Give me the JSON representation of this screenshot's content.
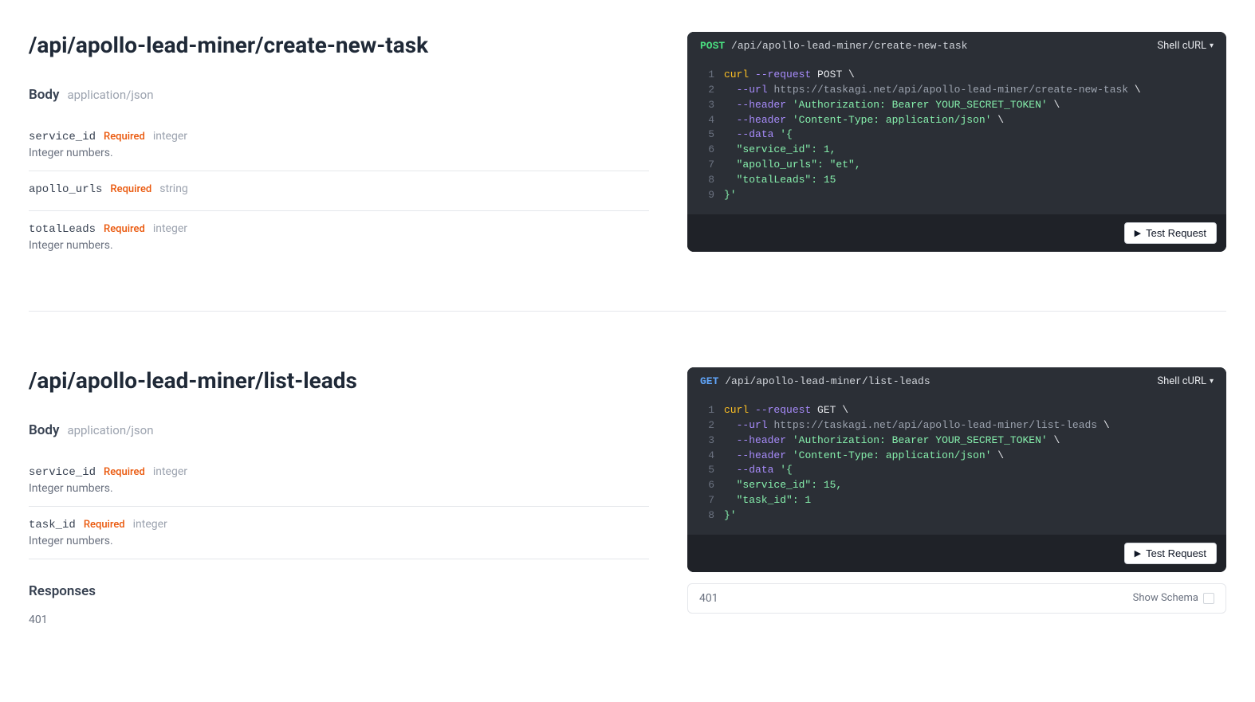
{
  "endpoints": [
    {
      "title": "/api/apollo-lead-miner/create-new-task",
      "body_label": "Body",
      "content_type": "application/json",
      "params": [
        {
          "name": "service_id",
          "required": "Required",
          "type": "integer",
          "desc": "Integer numbers."
        },
        {
          "name": "apollo_urls",
          "required": "Required",
          "type": "string",
          "desc": ""
        },
        {
          "name": "totalLeads",
          "required": "Required",
          "type": "integer",
          "desc": "Integer numbers."
        }
      ],
      "code": {
        "method": "POST",
        "path": "/api/apollo-lead-miner/create-new-task",
        "shell_label": "Shell cURL",
        "test_label": "Test Request",
        "lines": [
          {
            "n": "1",
            "tokens": [
              {
                "t": "curl",
                "c": "tok-cmd"
              },
              {
                "t": " ",
                "c": ""
              },
              {
                "t": "--request",
                "c": "tok-flag"
              },
              {
                "t": " POST \\",
                "c": "tok-plain"
              }
            ]
          },
          {
            "n": "2",
            "tokens": [
              {
                "t": "  ",
                "c": ""
              },
              {
                "t": "--url",
                "c": "tok-flag"
              },
              {
                "t": " ",
                "c": ""
              },
              {
                "t": "https://taskagi.net/api/apollo-lead-miner/create-new-task",
                "c": "tok-url"
              },
              {
                "t": " \\",
                "c": "tok-plain"
              }
            ]
          },
          {
            "n": "3",
            "tokens": [
              {
                "t": "  ",
                "c": ""
              },
              {
                "t": "--header",
                "c": "tok-flag"
              },
              {
                "t": " ",
                "c": ""
              },
              {
                "t": "'Authorization: Bearer YOUR_SECRET_TOKEN'",
                "c": "tok-str"
              },
              {
                "t": " \\",
                "c": "tok-plain"
              }
            ]
          },
          {
            "n": "4",
            "tokens": [
              {
                "t": "  ",
                "c": ""
              },
              {
                "t": "--header",
                "c": "tok-flag"
              },
              {
                "t": " ",
                "c": ""
              },
              {
                "t": "'Content-Type: application/json'",
                "c": "tok-str"
              },
              {
                "t": " \\",
                "c": "tok-plain"
              }
            ]
          },
          {
            "n": "5",
            "tokens": [
              {
                "t": "  ",
                "c": ""
              },
              {
                "t": "--data",
                "c": "tok-flag"
              },
              {
                "t": " ",
                "c": ""
              },
              {
                "t": "'{",
                "c": "tok-str"
              }
            ]
          },
          {
            "n": "6",
            "tokens": [
              {
                "t": "  \"service_id\": 1,",
                "c": "tok-str"
              }
            ]
          },
          {
            "n": "7",
            "tokens": [
              {
                "t": "  \"apollo_urls\": \"et\",",
                "c": "tok-str"
              }
            ]
          },
          {
            "n": "8",
            "tokens": [
              {
                "t": "  \"totalLeads\": 15",
                "c": "tok-str"
              }
            ]
          },
          {
            "n": "9",
            "tokens": [
              {
                "t": "}'",
                "c": "tok-str"
              }
            ]
          }
        ]
      }
    },
    {
      "title": "/api/apollo-lead-miner/list-leads",
      "body_label": "Body",
      "content_type": "application/json",
      "params": [
        {
          "name": "service_id",
          "required": "Required",
          "type": "integer",
          "desc": "Integer numbers."
        },
        {
          "name": "task_id",
          "required": "Required",
          "type": "integer",
          "desc": "Integer numbers."
        }
      ],
      "responses_label": "Responses",
      "responses": [
        {
          "code": "401"
        }
      ],
      "code": {
        "method": "GET",
        "path": "/api/apollo-lead-miner/list-leads",
        "shell_label": "Shell cURL",
        "test_label": "Test Request",
        "lines": [
          {
            "n": "1",
            "tokens": [
              {
                "t": "curl",
                "c": "tok-cmd"
              },
              {
                "t": " ",
                "c": ""
              },
              {
                "t": "--request",
                "c": "tok-flag"
              },
              {
                "t": " GET \\",
                "c": "tok-plain"
              }
            ]
          },
          {
            "n": "2",
            "tokens": [
              {
                "t": "  ",
                "c": ""
              },
              {
                "t": "--url",
                "c": "tok-flag"
              },
              {
                "t": " ",
                "c": ""
              },
              {
                "t": "https://taskagi.net/api/apollo-lead-miner/list-leads",
                "c": "tok-url"
              },
              {
                "t": " \\",
                "c": "tok-plain"
              }
            ]
          },
          {
            "n": "3",
            "tokens": [
              {
                "t": "  ",
                "c": ""
              },
              {
                "t": "--header",
                "c": "tok-flag"
              },
              {
                "t": " ",
                "c": ""
              },
              {
                "t": "'Authorization: Bearer YOUR_SECRET_TOKEN'",
                "c": "tok-str"
              },
              {
                "t": " \\",
                "c": "tok-plain"
              }
            ]
          },
          {
            "n": "4",
            "tokens": [
              {
                "t": "  ",
                "c": ""
              },
              {
                "t": "--header",
                "c": "tok-flag"
              },
              {
                "t": " ",
                "c": ""
              },
              {
                "t": "'Content-Type: application/json'",
                "c": "tok-str"
              },
              {
                "t": " \\",
                "c": "tok-plain"
              }
            ]
          },
          {
            "n": "5",
            "tokens": [
              {
                "t": "  ",
                "c": ""
              },
              {
                "t": "--data",
                "c": "tok-flag"
              },
              {
                "t": " ",
                "c": ""
              },
              {
                "t": "'{",
                "c": "tok-str"
              }
            ]
          },
          {
            "n": "6",
            "tokens": [
              {
                "t": "  \"service_id\": 15,",
                "c": "tok-str"
              }
            ]
          },
          {
            "n": "7",
            "tokens": [
              {
                "t": "  \"task_id\": 1",
                "c": "tok-str"
              }
            ]
          },
          {
            "n": "8",
            "tokens": [
              {
                "t": "}'",
                "c": "tok-str"
              }
            ]
          }
        ]
      },
      "response_box": {
        "code": "401",
        "show_schema": "Show Schema"
      }
    }
  ]
}
